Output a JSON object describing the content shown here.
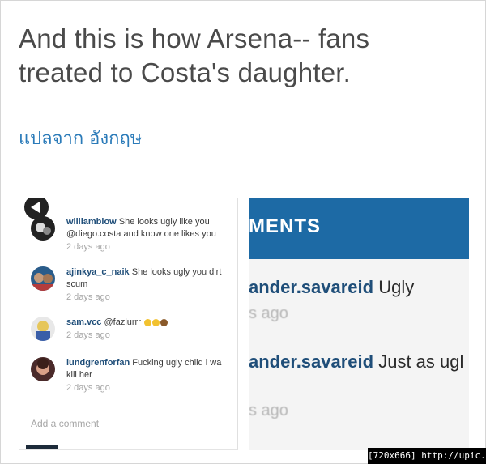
{
  "tweet": {
    "line1": "And this is how Arsena-- fans",
    "line2": "treated to Costa's daughter."
  },
  "translate_label": "แปลจาก อังกฤษ",
  "left_screenshot": {
    "comments": [
      {
        "user": "williamblow",
        "text_line1": " She looks ugly like you",
        "text_line2": "@diego.costa and know one likes you",
        "time": "2 days ago"
      },
      {
        "user": "ajinkya_c_naik",
        "text_line1": " She looks ugly you dirt",
        "text_line2": "scum",
        "time": "2 days ago"
      },
      {
        "user": "sam.vcc",
        "text_line1": " @fazlurrr",
        "text_line2": "",
        "time": "2 days ago"
      },
      {
        "user": "lundgrenforfan",
        "text_line1": " Fucking ugly child i wa",
        "text_line2": "kill her",
        "time": "2 days ago"
      }
    ],
    "add_comment_placeholder": "Add a comment"
  },
  "right_screenshot": {
    "header": "MENTS",
    "rows": [
      {
        "user": "ander.savareid",
        "text": " Ugly",
        "time": "s ago"
      },
      {
        "user": "ander.savareid",
        "text": " Just as ugl",
        "time": "s ago"
      }
    ]
  },
  "watermark": "[720x666] http://upic.me/",
  "colors": {
    "link": "#2b7bb9",
    "instagram_user": "#1f4e79",
    "header_blue": "#1d6aa5"
  }
}
